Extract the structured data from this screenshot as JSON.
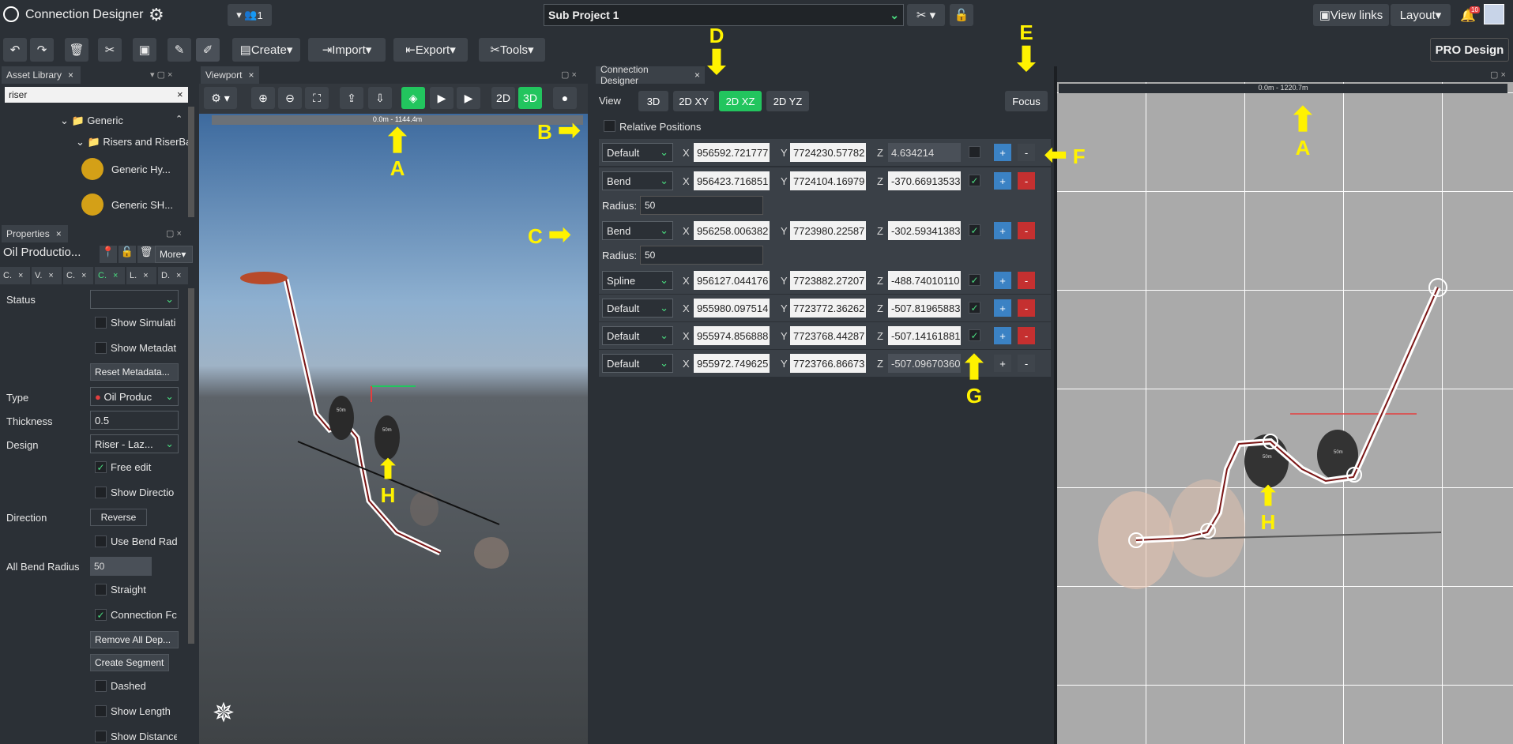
{
  "app": {
    "title": "Connection Designer",
    "project": "Sub Project 1",
    "users": "1",
    "view_links": "View links",
    "layout": "Layout",
    "notif": "10",
    "pro": "PRO Design"
  },
  "toolbar": {
    "create": "Create",
    "import": "Import",
    "export": "Export",
    "tools": "Tools"
  },
  "asset": {
    "tab": "Asset Library",
    "search": "riser",
    "tree": [
      "Generic",
      "Risers and RiserBa",
      "Generic Hy...",
      "Generic SH..."
    ]
  },
  "props": {
    "tab": "Properties",
    "name": "Oil Productio...",
    "more": "More",
    "subtabs": [
      "C.",
      "V.",
      "C.",
      "C.",
      "L.",
      "D."
    ],
    "status": "Status",
    "show_sim": "Show Simulati",
    "show_meta": "Show Metadat",
    "reset_meta": "Reset Metadata...",
    "type": "Type",
    "type_val": "Oil Produc",
    "thickness": "Thickness",
    "thickness_val": "0.5",
    "design": "Design",
    "design_val": "Riser - Laz...",
    "free_edit": "Free edit",
    "show_dir": "Show Directio",
    "direction": "Direction",
    "reverse": "Reverse",
    "use_bend": "Use Bend Rad",
    "all_bend": "All Bend Radius",
    "all_bend_val": "50",
    "straight": "Straight",
    "conn_f": "Connection Fc",
    "remove_all": "Remove All Dep...",
    "create_seg": "Create Segment",
    "dashed": "Dashed",
    "show_len": "Show Length",
    "show_dist": "Show Distance"
  },
  "viewport": {
    "tab": "Viewport",
    "scale": "0.0m - 1144.4m",
    "mode_2d": "2D",
    "mode_3d": "3D",
    "lbl1": "50m",
    "lbl2": "50m"
  },
  "cd": {
    "tab": "Connection Designer",
    "view": "View",
    "v3d": "3D",
    "vxy": "2D XY",
    "vxz": "2D XZ",
    "vyz": "2D YZ",
    "focus": "Focus",
    "relative": "Relative Positions",
    "radius_lbl": "Radius:",
    "rows": [
      {
        "type": "Default",
        "x": "956592.721777",
        "y": "7724230.57782",
        "z": "4.634214",
        "checked": "",
        "radius": ""
      },
      {
        "type": "Bend",
        "x": "956423.716851",
        "y": "7724104.16979",
        "z": "-370.66913533",
        "checked": "✓",
        "radius": "50"
      },
      {
        "type": "Bend",
        "x": "956258.006382",
        "y": "7723980.22587",
        "z": "-302.59341383",
        "checked": "✓",
        "radius": "50"
      },
      {
        "type": "Spline",
        "x": "956127.044176",
        "y": "7723882.27207",
        "z": "-488.74010110",
        "checked": "✓",
        "radius": ""
      },
      {
        "type": "Default",
        "x": "955980.097514",
        "y": "7723772.36262",
        "z": "-507.81965883",
        "checked": "✓",
        "radius": ""
      },
      {
        "type": "Default",
        "x": "955974.856888",
        "y": "7723768.44287",
        "z": "-507.14161881",
        "checked": "✓",
        "radius": ""
      },
      {
        "type": "Default",
        "x": "955972.749625",
        "y": "7723766.86673",
        "z": "-507.09670360",
        "checked": "",
        "radius": ""
      }
    ]
  },
  "view2d": {
    "scale": "0.0m - 1220.7m",
    "lbl1": "50m",
    "lbl2": "50m"
  },
  "annotations": [
    "A",
    "B",
    "C",
    "D",
    "E",
    "F",
    "G",
    "H",
    "A",
    "H"
  ]
}
